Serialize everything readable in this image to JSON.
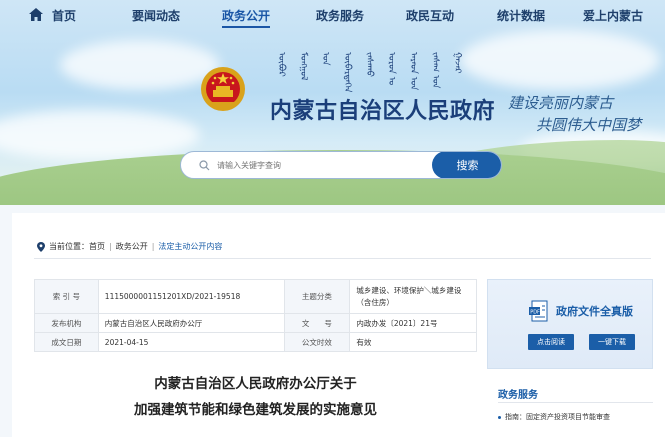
{
  "nav": {
    "items": [
      {
        "label": "首页"
      },
      {
        "label": "要闻动态"
      },
      {
        "label": "政务公开"
      },
      {
        "label": "政务服务"
      },
      {
        "label": "政民互动"
      },
      {
        "label": "统计数据"
      },
      {
        "label": "爱上内蒙古"
      }
    ],
    "active_index": 2
  },
  "header": {
    "title": "内蒙古自治区人民政府",
    "mongolian_script": "ᠦᠪᠦᠷ ᠮᠣᠩᠭᠣᠯ ᠤᠨ ᠥᠪᠡᠷᠲᠡᠭᠡᠨ ᠵᠠᠰᠠᠬᠤ ᠣᠷᠣᠨ ᠤ ᠠᠷᠠᠳ ᠤᠨ ᠵᠠᠰᠠᠭ ᠤᠨ ᠭᠠᠵᠠᠷ",
    "slogan_line1": "建设亮丽内蒙古",
    "slogan_line2": "共圆伟大中国梦"
  },
  "search": {
    "placeholder": "请输入关键字查询",
    "button_label": "搜索"
  },
  "breadcrumb": {
    "prefix": "当前位置：",
    "items": [
      "首页",
      "政务公开",
      "法定主动公开内容"
    ]
  },
  "meta_table": {
    "index_label": "索 引 号",
    "index_value": "1115000001151201XD/2021-19518",
    "category_label": "主题分类",
    "category_value": "城乡建设、环境保护＼城乡建设（含住房）",
    "publisher_label": "发布机构",
    "publisher_value": "内蒙古自治区人民政府办公厅",
    "docno_label": "文　　号",
    "docno_value": "内政办发〔2021〕21号",
    "date_label": "成文日期",
    "date_value": "2021-04-15",
    "validity_label": "公文时效",
    "validity_value": "有效"
  },
  "doc_card": {
    "title": "政府文件全真版",
    "read_label": "点击阅读",
    "download_label": "一键下载"
  },
  "document": {
    "title_line1": "内蒙古自治区人民政府办公厅关于",
    "title_line2": "加强建筑节能和绿色建筑发展的实施意见"
  },
  "sidebar": {
    "title": "政务服务",
    "items": [
      {
        "label": "指南：固定资产投资项目节能审查"
      }
    ]
  },
  "colors": {
    "primary": "#1b5ea8",
    "nav_text": "#1e3f6b",
    "title": "#1b3f7a"
  }
}
